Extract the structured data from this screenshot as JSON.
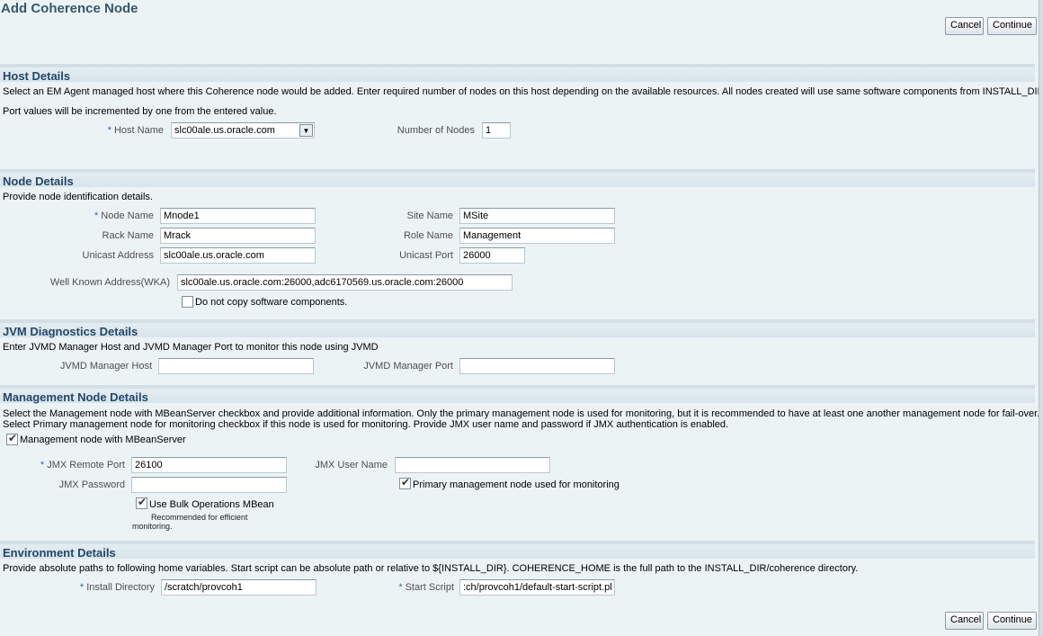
{
  "page": {
    "title": "Add Coherence Node",
    "cancel_label": "Cancel",
    "continue_label": "Continue"
  },
  "host": {
    "header": "Host Details",
    "desc1": "Select an EM Agent managed host where this Coherence node would be added. Enter required number of nodes on this host depending on the available resources. All nodes created will use same software components from INSTALL_DIR.",
    "desc2": "Port values will be incremented by one from the entered value.",
    "host_name_label": "Host Name",
    "host_name_value": "slc00ale.us.oracle.com",
    "num_nodes_label": "Number of Nodes",
    "num_nodes_value": "1"
  },
  "node": {
    "header": "Node Details",
    "desc": "Provide node identification details.",
    "node_name_label": "Node Name",
    "node_name_value": "Mnode1",
    "site_name_label": "Site Name",
    "site_name_value": "MSite",
    "rack_name_label": "Rack Name",
    "rack_name_value": "Mrack",
    "role_name_label": "Role Name",
    "role_name_value": "Management",
    "unicast_address_label": "Unicast Address",
    "unicast_address_value": "slc00ale.us.oracle.com",
    "unicast_port_label": "Unicast Port",
    "unicast_port_value": "26000",
    "wka_label": "Well Known Address(WKA)",
    "wka_value": "slc00ale.us.oracle.com:26000,adc6170569.us.oracle.com:26000",
    "no_copy_label": "Do not copy software components.",
    "no_copy_checked": false
  },
  "jvm": {
    "header": "JVM Diagnostics Details",
    "desc": "Enter JVMD Manager Host and JVMD Manager Port to monitor this node using JVMD",
    "host_label": "JVMD Manager Host",
    "host_value": "",
    "port_label": "JVMD Manager Port",
    "port_value": ""
  },
  "mgmt": {
    "header": "Management Node Details",
    "desc1": "Select the Management node with MBeanServer checkbox and provide additional information. Only the primary management node is used for monitoring, but it is recommended to have at least one another management node for fail-over.",
    "desc2": "Select Primary management node for monitoring checkbox if this node is used for monitoring. Provide JMX user name and password if JMX authentication is enabled.",
    "mbean_label": "Management node with MBeanServer",
    "mbean_checked": true,
    "jmx_port_label": "JMX Remote Port",
    "jmx_port_value": "26100",
    "jmx_user_label": "JMX User Name",
    "jmx_user_value": "",
    "jmx_pass_label": "JMX Password",
    "jmx_pass_value": "",
    "primary_label": "Primary management node used for monitoring",
    "primary_checked": true,
    "bulk_label": "Use Bulk Operations MBean",
    "bulk_checked": true,
    "bulk_hint1": "Recommended for efficient",
    "bulk_hint2": "monitoring."
  },
  "env": {
    "header": "Environment Details",
    "desc": "Provide absolute paths to following home variables. Start script can be absolute path or relative to ${INSTALL_DIR}. COHERENCE_HOME is the full path to the INSTALL_DIR/coherence directory.",
    "install_label": "Install Directory",
    "install_value": "/scratch/provcoh1",
    "script_label": "Start Script",
    "script_value": ":ch/provcoh1/default-start-script.pl"
  },
  "colors": {
    "background": "#ecf3f5",
    "header_text": "#24476a",
    "required_marker": "#2e65a6"
  }
}
